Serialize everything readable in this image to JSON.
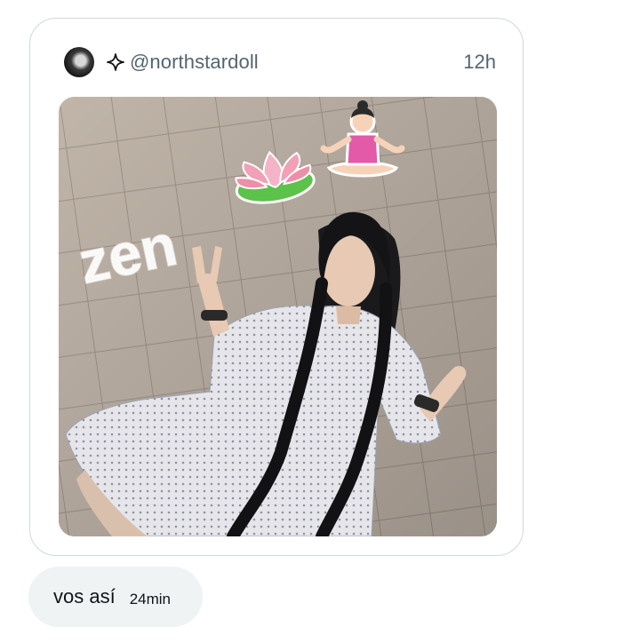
{
  "quote": {
    "handle": "@northstardoll",
    "time": "12h",
    "avatar_icon": "avatar-photo",
    "verified_icon": "sparkle-icon",
    "media": {
      "overlay_text": "zen",
      "stickers": [
        "lotus-emoji",
        "person-meditating-emoji"
      ]
    }
  },
  "message": {
    "text": "vos así",
    "time": "24min"
  },
  "colors": {
    "border": "#cfd9de",
    "secondary_text": "#536471",
    "bubble_bg": "#eff3f4",
    "primary_text": "#0f1419"
  }
}
